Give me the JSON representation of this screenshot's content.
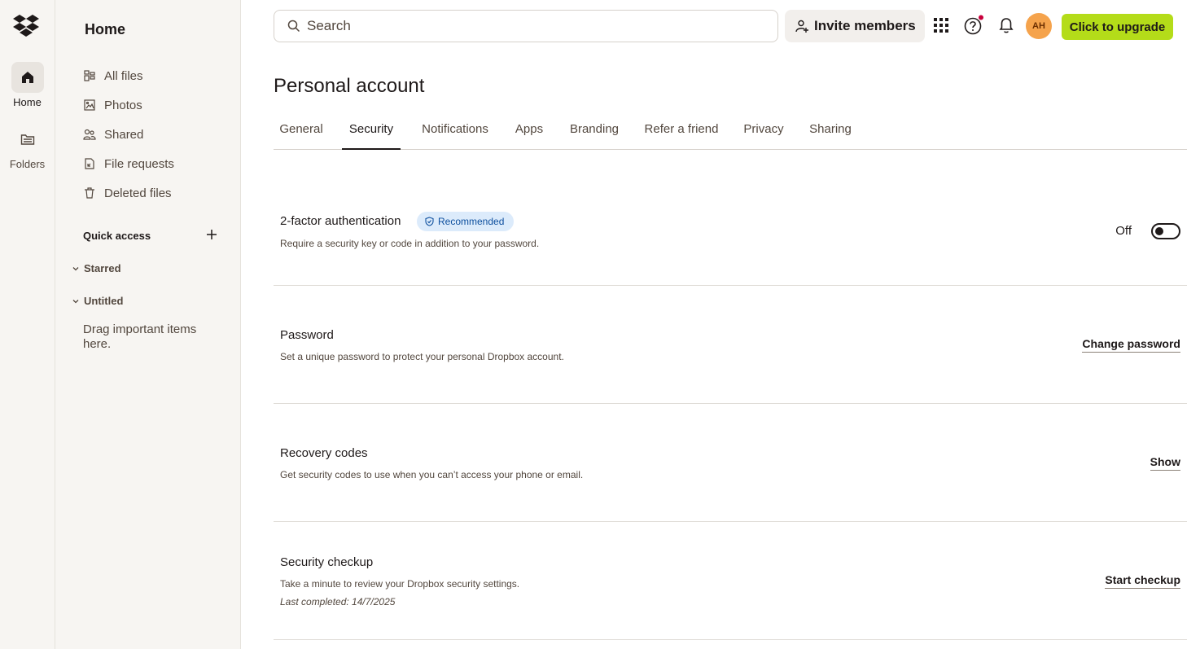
{
  "rail": {
    "items": [
      {
        "label": "Home",
        "icon": "home-icon",
        "active": true
      },
      {
        "label": "Folders",
        "icon": "folder-icon",
        "active": false
      }
    ]
  },
  "sidebar": {
    "title": "Home",
    "items": [
      {
        "label": "All files",
        "icon": "all-files-icon"
      },
      {
        "label": "Photos",
        "icon": "photos-icon"
      },
      {
        "label": "Shared",
        "icon": "shared-icon"
      },
      {
        "label": "File requests",
        "icon": "file-request-icon"
      },
      {
        "label": "Deleted files",
        "icon": "trash-icon"
      }
    ],
    "quick_access": {
      "title": "Quick access",
      "groups": [
        {
          "label": "Starred"
        },
        {
          "label": "Untitled"
        }
      ],
      "hint": "Drag important items here."
    }
  },
  "topbar": {
    "search_placeholder": "Search",
    "invite_label": "Invite members",
    "avatar_initials": "AH",
    "upgrade_label": "Click to upgrade"
  },
  "main": {
    "title": "Personal account",
    "tabs": [
      {
        "label": "General"
      },
      {
        "label": "Security",
        "active": true
      },
      {
        "label": "Notifications"
      },
      {
        "label": "Apps"
      },
      {
        "label": "Branding"
      },
      {
        "label": "Refer a friend"
      },
      {
        "label": "Privacy"
      },
      {
        "label": "Sharing"
      }
    ],
    "settings": {
      "two_factor": {
        "title": "2-factor authentication",
        "badge": "Recommended",
        "description": "Require a security key or code in addition to your password.",
        "status": "Off"
      },
      "password": {
        "title": "Password",
        "description": "Set a unique password to protect your personal Dropbox account.",
        "action": "Change password"
      },
      "recovery": {
        "title": "Recovery codes",
        "description": "Get security codes to use when you can’t access your phone or email.",
        "action": "Show"
      },
      "checkup": {
        "title": "Security checkup",
        "description": "Take a minute to review your Dropbox security settings.",
        "note": "Last completed: 14/7/2025",
        "action": "Start checkup"
      }
    }
  },
  "colors": {
    "upgrade_bg": "#b4dc19",
    "avatar_bg": "#f5a34c",
    "badge_bg": "#dcebfb",
    "badge_text": "#0d4f9e",
    "notification_dot": "#c8003c"
  }
}
